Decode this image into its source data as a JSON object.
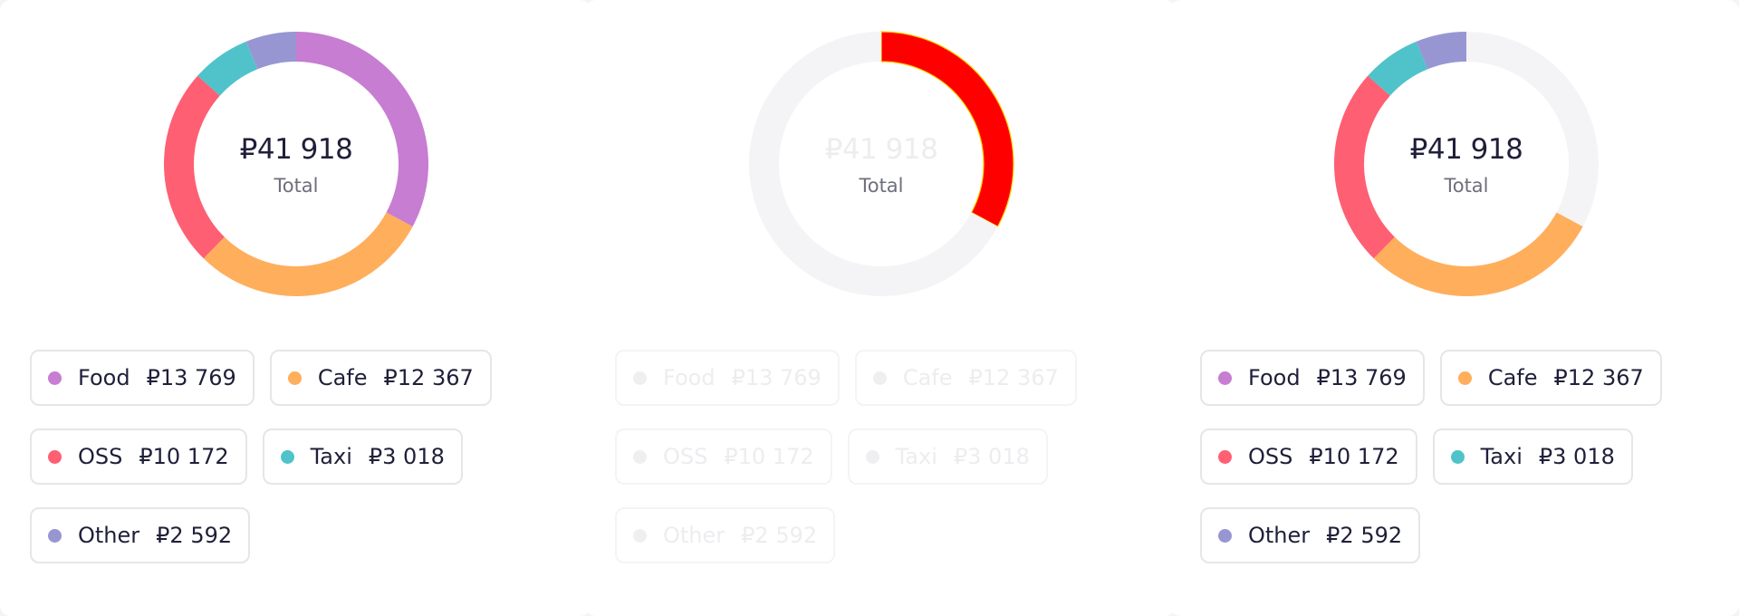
{
  "chart_data": [
    {
      "type": "pie",
      "style": "donut",
      "center_value": "₽41 918",
      "center_label": "Total",
      "categories": [
        "Food",
        "Cafe",
        "OSS",
        "Taxi",
        "Other"
      ],
      "values": [
        13769,
        12367,
        10172,
        3018,
        2592
      ],
      "value_labels": [
        "₽13 769",
        "₽12 367",
        "₽10 172",
        "₽3 018",
        "₽2 592"
      ],
      "colors": [
        "#c77dd2",
        "#ffae5c",
        "#ff5f72",
        "#4fc3c9",
        "#9896d2"
      ],
      "state": "all segments visible"
    },
    {
      "type": "pie",
      "style": "donut",
      "center_value": "₽41 918",
      "center_label": "Total",
      "categories": [
        "Food",
        "Cafe",
        "OSS",
        "Taxi",
        "Other"
      ],
      "values": [
        13769,
        12367,
        10172,
        3018,
        2592
      ],
      "value_labels": [
        "₽13 769",
        "₽12 367",
        "₽10 172",
        "₽3 018",
        "₽2 592"
      ],
      "colors": [
        "#ff0000",
        "#f4f4f6",
        "#f4f4f6",
        "#f4f4f6",
        "#f4f4f6"
      ],
      "state": "Food segment highlighted in red, rest faded"
    },
    {
      "type": "pie",
      "style": "donut",
      "center_value": "₽41 918",
      "center_label": "Total",
      "categories": [
        "Food",
        "Cafe",
        "OSS",
        "Taxi",
        "Other"
      ],
      "values": [
        13769,
        12367,
        10172,
        3018,
        2592
      ],
      "value_labels": [
        "₽13 769",
        "₽12 367",
        "₽10 172",
        "₽3 018",
        "₽2 592"
      ],
      "colors": [
        "#f4f4f6",
        "#ffae5c",
        "#ff5f72",
        "#4fc3c9",
        "#9896d2"
      ],
      "state": "Food segment hidden"
    }
  ]
}
